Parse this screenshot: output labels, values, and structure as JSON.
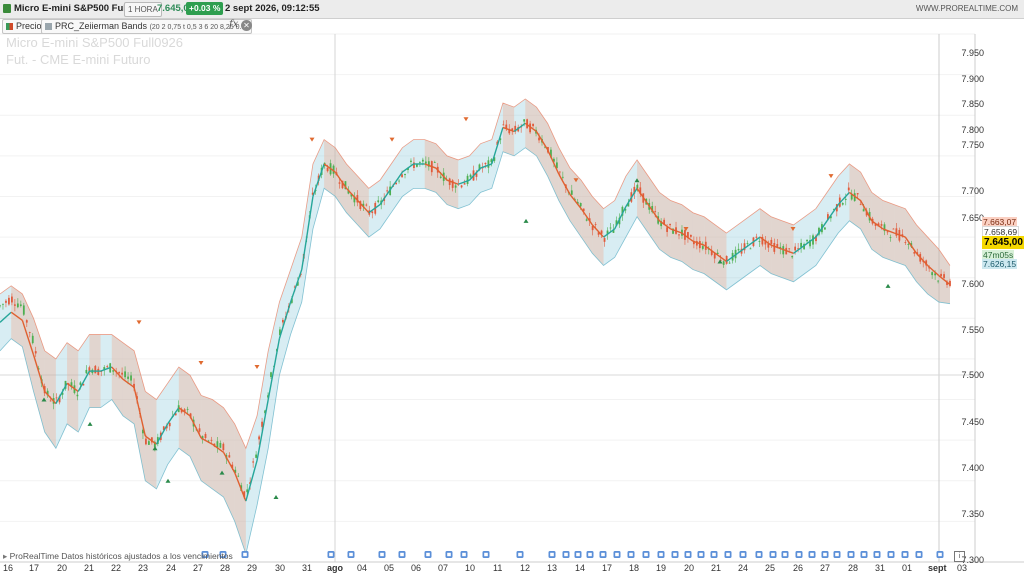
{
  "header": {
    "instrument": "Micro E-mini S&P500 Full0926",
    "timeframe": "1 HORA",
    "last_price": "7.645,00",
    "change_pct": "+0.03 %",
    "datetime": "2 sept 2026, 09:12:55",
    "site": "WWW.PROREALTIME.COM"
  },
  "indicators": {
    "precio_label": "Precio",
    "bands_label": "PRC_Zeiierman Bands",
    "bands_params": "(20 2 0,75 t 0,5 3 6 20 8,25 0...)",
    "fx_label": "fx"
  },
  "watermark": {
    "line1": "Micro E-mini S&P500 Full0926",
    "line2": "Fut. - CME E-mini  Futuro"
  },
  "price_axis": {
    "ticks": [
      "7.950",
      "7.900",
      "7.850",
      "7.800",
      "7.750",
      "7.700",
      "7.650",
      "7.600",
      "7.550",
      "7.500",
      "7.450",
      "7.400",
      "7.350",
      "7.300"
    ],
    "labels": {
      "upper": "7.663,07",
      "mid": "7.658,69",
      "last": "7.645,00",
      "timer": "47m05s",
      "lower": "7.626,15"
    }
  },
  "time_axis": {
    "labels": [
      "16",
      "17",
      "20",
      "21",
      "22",
      "23",
      "24",
      "27",
      "28",
      "29",
      "30",
      "31",
      "ago",
      "04",
      "05",
      "06",
      "07",
      "10",
      "11",
      "12",
      "13",
      "14",
      "17",
      "18",
      "19",
      "20",
      "21",
      "24",
      "25",
      "26",
      "27",
      "28",
      "31",
      "01",
      "sept",
      "03"
    ]
  },
  "footer": {
    "text": "ProRealTime Datos históricos ajustados a los vencimientos"
  },
  "colors": {
    "up": "#26a69a",
    "down": "#e06030",
    "band_orange": "#f4a98c",
    "band_blue": "#8ecbdc",
    "last_price_bg": "#f5d800"
  },
  "chart_data": {
    "type": "line",
    "title": "",
    "y_range": [
      7300,
      7950
    ],
    "x_labels": [
      "16",
      "17",
      "20",
      "21",
      "22",
      "23",
      "24",
      "27",
      "28",
      "29",
      "30",
      "31",
      "ago",
      "04",
      "05",
      "06",
      "07",
      "10",
      "11",
      "12",
      "13",
      "14",
      "17",
      "18",
      "19",
      "20",
      "21",
      "24",
      "25",
      "26",
      "27",
      "28",
      "31",
      "01",
      "sept",
      "03"
    ],
    "anchors_x": [
      0,
      3,
      6,
      9,
      12,
      15,
      18,
      21,
      24,
      27,
      30,
      33,
      36,
      39,
      42,
      45,
      48,
      51,
      54,
      57,
      60,
      63,
      66,
      69,
      72,
      75,
      78,
      81,
      84,
      87,
      90,
      93,
      96,
      99,
      102,
      105,
      108,
      111,
      114,
      117,
      120,
      123,
      126,
      129,
      132,
      135,
      138,
      141,
      144,
      147,
      150,
      153,
      156,
      159,
      162,
      165,
      168,
      171,
      174,
      177,
      180,
      183,
      186,
      189,
      192,
      195,
      198,
      201,
      204,
      207,
      210,
      213,
      216,
      219,
      222,
      225,
      228,
      231,
      234,
      237,
      240,
      243,
      246,
      249,
      252,
      255,
      258,
      261,
      264,
      267,
      270,
      273,
      276,
      279,
      282,
      285,
      288,
      291,
      294,
      297,
      300,
      303,
      306,
      309,
      312,
      315
    ],
    "price": [
      7615,
      7625,
      7615,
      7570,
      7510,
      7495,
      7520,
      7510,
      7540,
      7535,
      7540,
      7530,
      7520,
      7450,
      7445,
      7470,
      7490,
      7480,
      7455,
      7445,
      7440,
      7415,
      7380,
      7440,
      7510,
      7580,
      7620,
      7660,
      7750,
      7790,
      7780,
      7760,
      7745,
      7730,
      7740,
      7760,
      7780,
      7790,
      7790,
      7785,
      7770,
      7765,
      7770,
      7785,
      7790,
      7835,
      7830,
      7840,
      7830,
      7810,
      7780,
      7755,
      7735,
      7715,
      7700,
      7710,
      7740,
      7760,
      7740,
      7720,
      7710,
      7705,
      7695,
      7690,
      7680,
      7670,
      7680,
      7690,
      7700,
      7690,
      7685,
      7680,
      7690,
      7700,
      7720,
      7740,
      7755,
      7745,
      7720,
      7710,
      7705,
      7700,
      7680,
      7665,
      7650,
      7645
    ],
    "lower_band": [
      7560,
      7575,
      7565,
      7510,
      7460,
      7440,
      7470,
      7460,
      7490,
      7490,
      7500,
      7480,
      7470,
      7400,
      7390,
      7420,
      7440,
      7430,
      7400,
      7390,
      7380,
      7350,
      7310,
      7370,
      7440,
      7530,
      7580,
      7620,
      7710,
      7760,
      7750,
      7730,
      7715,
      7700,
      7710,
      7730,
      7750,
      7760,
      7760,
      7755,
      7740,
      7735,
      7740,
      7755,
      7760,
      7805,
      7800,
      7810,
      7800,
      7775,
      7745,
      7720,
      7700,
      7680,
      7665,
      7675,
      7700,
      7725,
      7705,
      7685,
      7675,
      7670,
      7660,
      7655,
      7645,
      7635,
      7645,
      7655,
      7665,
      7655,
      7650,
      7645,
      7655,
      7665,
      7685,
      7705,
      7720,
      7710,
      7685,
      7675,
      7670,
      7665,
      7645,
      7630,
      7620,
      7618
    ],
    "upper_band": [
      7630,
      7640,
      7630,
      7600,
      7560,
      7550,
      7570,
      7560,
      7580,
      7580,
      7580,
      7570,
      7560,
      7510,
      7500,
      7520,
      7540,
      7530,
      7505,
      7500,
      7490,
      7470,
      7440,
      7480,
      7560,
      7620,
      7660,
      7700,
      7790,
      7820,
      7810,
      7790,
      7775,
      7760,
      7770,
      7790,
      7810,
      7820,
      7820,
      7815,
      7800,
      7795,
      7800,
      7815,
      7820,
      7865,
      7860,
      7870,
      7860,
      7840,
      7810,
      7785,
      7770,
      7750,
      7735,
      7745,
      7775,
      7795,
      7775,
      7755,
      7745,
      7740,
      7730,
      7725,
      7715,
      7705,
      7715,
      7725,
      7735,
      7725,
      7720,
      7715,
      7725,
      7735,
      7755,
      7775,
      7790,
      7780,
      7755,
      7745,
      7740,
      7735,
      7715,
      7700,
      7685,
      7665
    ],
    "signals_down": [
      7595,
      7545,
      7540,
      7820,
      7820,
      7845,
      7770,
      7710,
      7710,
      7775
    ],
    "signals_up": [
      7500,
      7470,
      7440,
      7400,
      7410,
      7380,
      7720,
      7770,
      7670,
      7640
    ]
  }
}
